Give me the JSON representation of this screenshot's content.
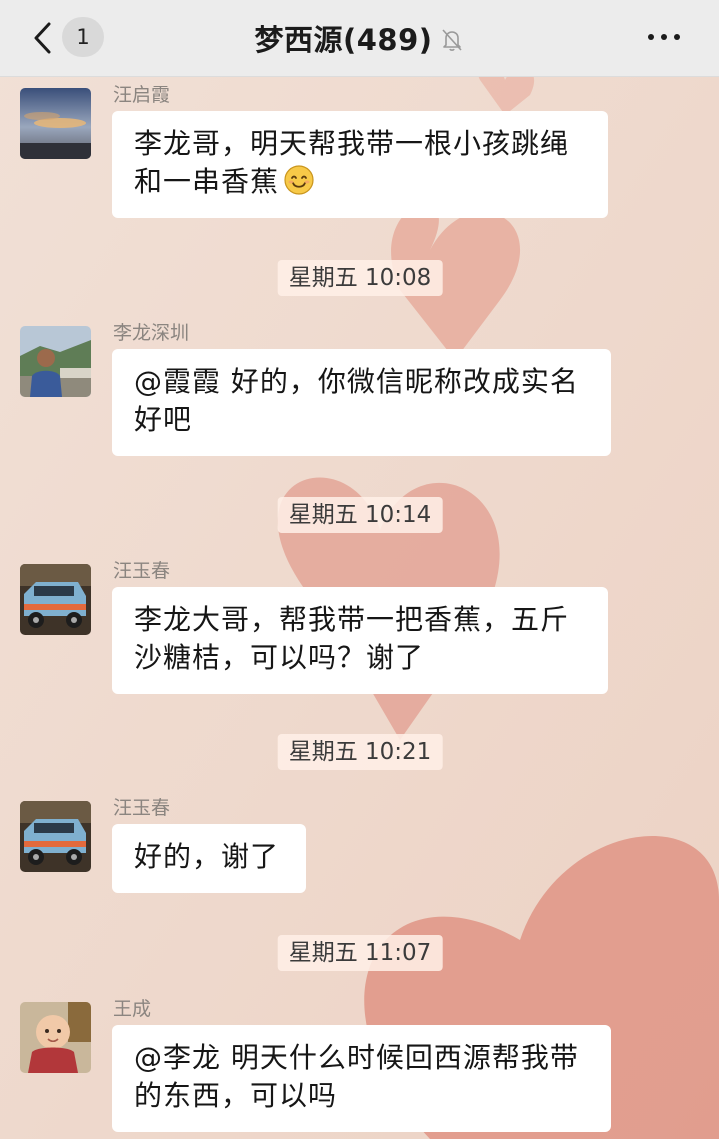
{
  "header": {
    "unread_count": "1",
    "title": "梦西源(489)",
    "muted": true,
    "icons": [
      "chevron-left-icon",
      "bell-muted-icon",
      "more-icon"
    ]
  },
  "messages": [
    {
      "sender": "汪启霞",
      "text_line1": "李龙哥，明天帮我带一根小孩跳绳",
      "text_line2": "和一串香蕉",
      "emoji": "smiling-face"
    },
    {
      "sender": "李龙深圳",
      "text_line1": "@霞霞 好的，你微信昵称改成实名",
      "text_line2": "好吧"
    },
    {
      "sender": "汪玉春",
      "text_line1": "李龙大哥，帮我带一把香蕉，五斤",
      "text_line2": "沙糖桔，可以吗？谢了"
    },
    {
      "sender": "汪玉春",
      "text_line1": "好的，谢了"
    },
    {
      "sender": "王成",
      "text_line1": "@李龙 明天什么时候回西源帮我带",
      "text_line2": "的东西，可以吗"
    }
  ],
  "timestamps": [
    "星期五 10:08",
    "星期五 10:14",
    "星期五 10:21",
    "星期五 11:07"
  ],
  "colors": {
    "header_bg": "#ececec",
    "chat_bg": "#efd8cb",
    "heart": "#e2998a",
    "bubble": "#ffffff"
  }
}
